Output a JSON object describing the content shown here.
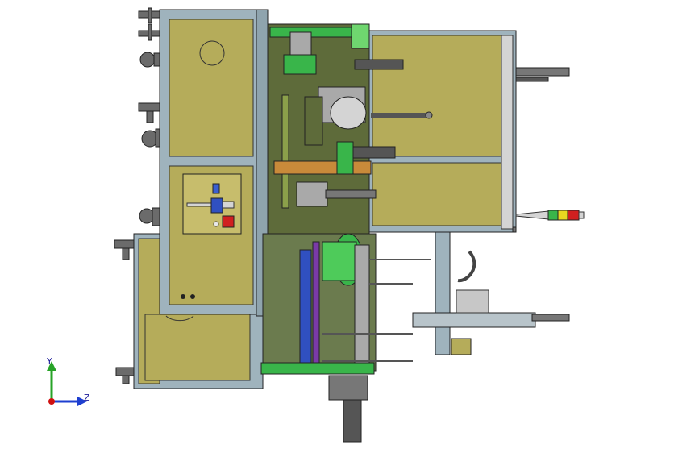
{
  "viewport": {
    "background": "#ffffff",
    "palette": {
      "panel_olive": "#b5ac5a",
      "panel_olive_dark": "#8f8844",
      "frame_blue_grey": "#9fb3bd",
      "frame_dark": "#5a6a72",
      "line_dark": "#2a2a2a",
      "green_part": "#39b54a",
      "bright_green": "#6fd66f",
      "metal_grey": "#a9a9a9",
      "metal_light": "#d4d4d4",
      "red_button": "#d02020",
      "blue_part": "#3050c0",
      "purple_part": "#7a3aa8"
    },
    "stack_light_colors": [
      "#39b54a",
      "#e8d820",
      "#d02020"
    ]
  },
  "triad": {
    "y_label": "Y",
    "z_label": "Z",
    "y_color": "#27a327",
    "z_color": "#1e3fd0",
    "x_color": "#d01010"
  }
}
